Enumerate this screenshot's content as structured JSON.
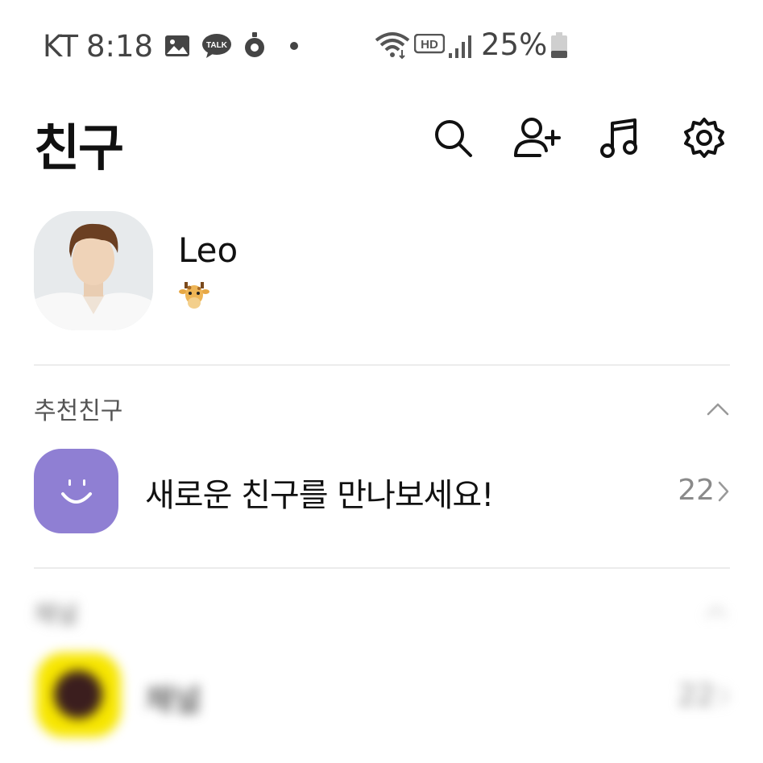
{
  "status_bar": {
    "carrier": "KT",
    "time": "8:18",
    "notification_icons": [
      "gallery-icon",
      "talk-bubble-icon",
      "location-pin-icon",
      "dot-icon"
    ],
    "talk_badge": "TALK",
    "hd_badge": "HD",
    "battery": "25%"
  },
  "header": {
    "title": "친구",
    "actions": [
      "search-icon",
      "add-friend-icon",
      "music-icon",
      "settings-icon"
    ]
  },
  "profile": {
    "name": "Leo",
    "status_emoji": "🦒"
  },
  "recommended": {
    "section_title": "추천친구",
    "item_label": "새로운 친구를 만나보세요!",
    "item_count": "22"
  },
  "channel": {
    "section_title": "채널",
    "item_label": "채널",
    "item_count": "22"
  },
  "colors": {
    "recommend_icon": "#8f7fd3",
    "channel_icon": "#f7e600",
    "divider": "#ececec"
  }
}
